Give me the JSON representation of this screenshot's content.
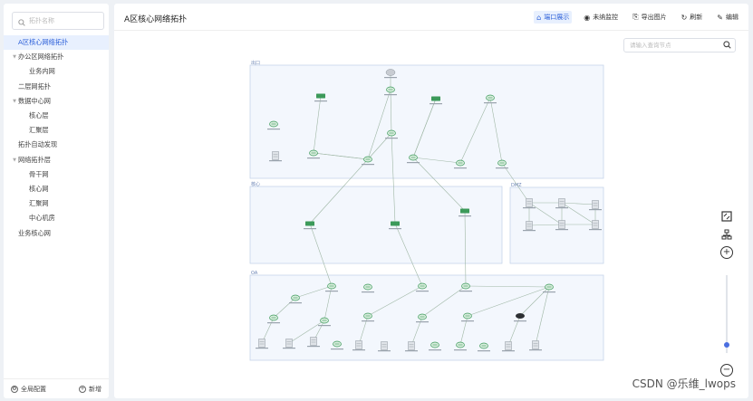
{
  "sidebar": {
    "search_placeholder": "拓扑名称",
    "items": [
      {
        "label": "A区核心网络拓扑",
        "level": 0,
        "arrow": "",
        "active": true
      },
      {
        "label": "办公区网络拓扑",
        "level": 0,
        "arrow": "▼"
      },
      {
        "label": "业务内网",
        "level": 1,
        "arrow": ""
      },
      {
        "label": "二层网拓扑",
        "level": 0,
        "arrow": ""
      },
      {
        "label": "数据中心网",
        "level": 0,
        "arrow": "▼"
      },
      {
        "label": "核心层",
        "level": 1,
        "arrow": ""
      },
      {
        "label": "汇聚层",
        "level": 1,
        "arrow": ""
      },
      {
        "label": "拓扑自动发现",
        "level": 0,
        "arrow": ""
      },
      {
        "label": "网络拓扑层",
        "level": 0,
        "arrow": "▼"
      },
      {
        "label": "骨干网",
        "level": 1,
        "arrow": ""
      },
      {
        "label": "核心网",
        "level": 1,
        "arrow": ""
      },
      {
        "label": "汇聚网",
        "level": 1,
        "arrow": ""
      },
      {
        "label": "中心机房",
        "level": 1,
        "arrow": ""
      },
      {
        "label": "业务核心网",
        "level": 0,
        "arrow": ""
      }
    ],
    "footer": {
      "config_label": "全局配置",
      "add_label": "新增"
    }
  },
  "header": {
    "title": "A区核心网络拓扑",
    "tools": [
      {
        "label": "端口展示",
        "icon": "home-icon",
        "active": true
      },
      {
        "label": "未纳监控",
        "icon": "monitor-icon"
      },
      {
        "label": "导出图片",
        "icon": "export-icon"
      },
      {
        "label": "刷新",
        "icon": "refresh-icon"
      },
      {
        "label": "编辑",
        "icon": "edit-icon"
      }
    ]
  },
  "topology": {
    "node_search_placeholder": "请输入查询节点",
    "zones": [
      {
        "id": "z1",
        "label": "出口"
      },
      {
        "id": "z2",
        "label": "核心"
      },
      {
        "id": "z3",
        "label": "DMZ"
      },
      {
        "id": "z4",
        "label": "OA"
      }
    ],
    "zoom_level": 0.1
  },
  "watermark": "CSDN @乐维_lwops",
  "colors": {
    "accent": "#2b5fd9",
    "zone_fill": "#f3f7fd",
    "zone_border": "#c6d4ea",
    "node_green": "#3c9a5a"
  }
}
